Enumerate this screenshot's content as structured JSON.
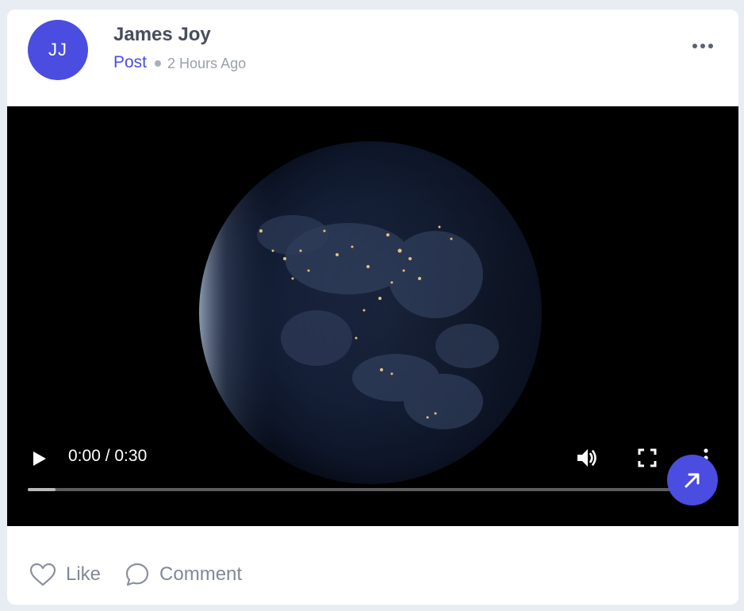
{
  "post": {
    "author": {
      "initials": "JJ",
      "name": "James Joy"
    },
    "type_label": "Post",
    "timestamp": "2 Hours Ago"
  },
  "video": {
    "time_display": "0:00 / 0:30",
    "progress_buffered_fraction": 0.04
  },
  "actions": {
    "like_label": "Like",
    "comment_label": "Comment"
  },
  "colors": {
    "accent": "#4a4de0",
    "page_background": "#e8ecf3",
    "card_background": "#ffffff",
    "name_text": "#464d5c",
    "muted_text": "#9aa1ad",
    "action_text": "#818898"
  },
  "icons": {
    "more": "more-horizontal-icon",
    "play": "play-icon",
    "volume": "volume-icon",
    "fullscreen": "fullscreen-icon",
    "video_menu": "more-vertical-icon",
    "fab": "arrow-up-right-icon",
    "like": "heart-icon",
    "comment": "comment-bubble-icon"
  }
}
